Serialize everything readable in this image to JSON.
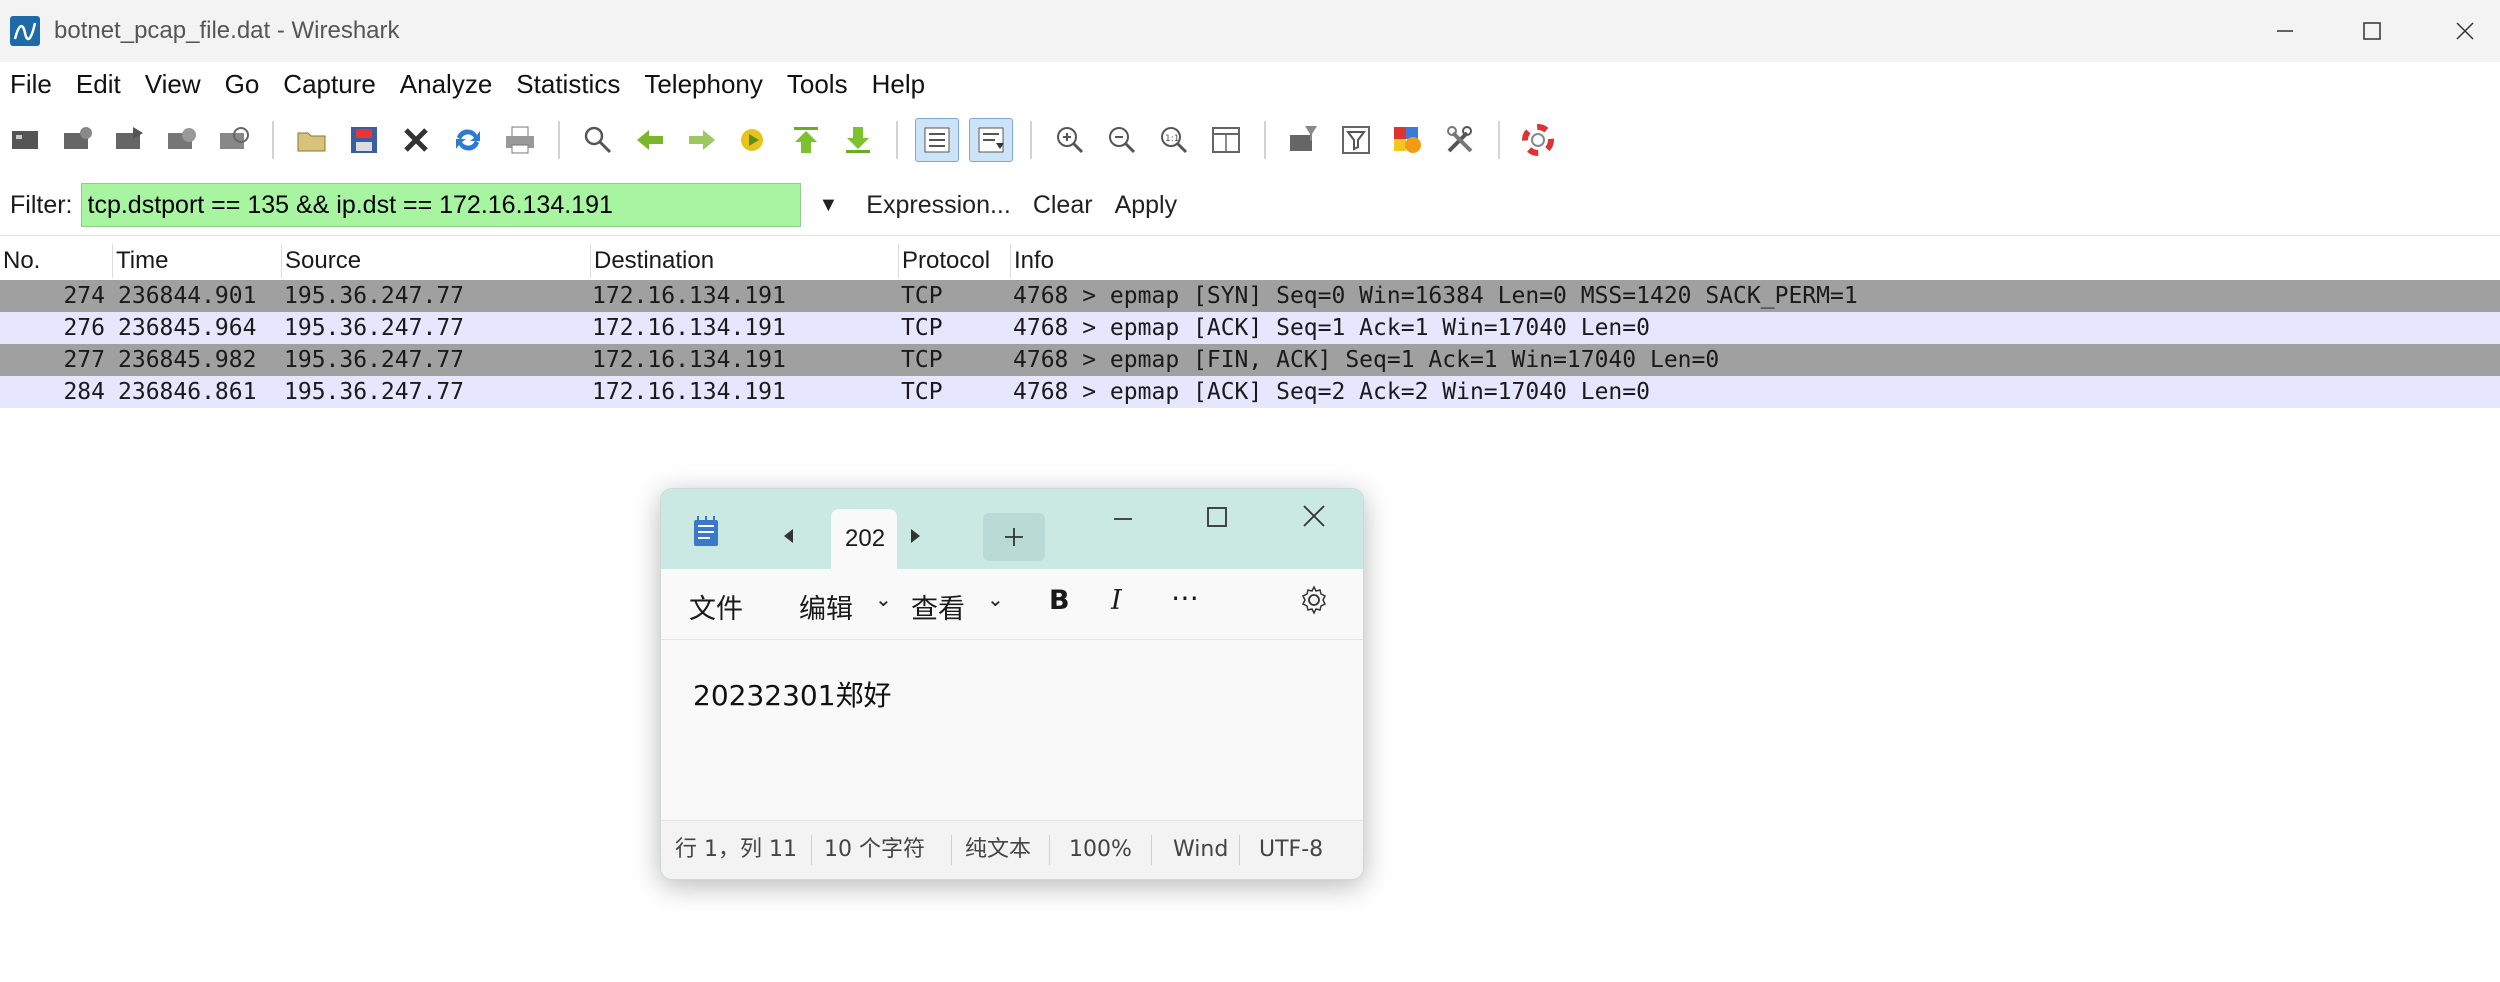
{
  "window": {
    "title": "botnet_pcap_file.dat - Wireshark"
  },
  "menu": [
    "File",
    "Edit",
    "View",
    "Go",
    "Capture",
    "Analyze",
    "Statistics",
    "Telephony",
    "Tools",
    "Help"
  ],
  "toolbar_icons": [
    "interfaces-icon",
    "options-icon",
    "start-capture-icon",
    "stop-capture-icon",
    "restart-capture-icon",
    "open-file-icon",
    "save-file-icon",
    "close-file-icon",
    "reload-icon",
    "print-icon",
    "find-packet-icon",
    "go-back-icon",
    "go-forward-icon",
    "go-to-packet-icon",
    "first-packet-icon",
    "last-packet-icon",
    "colorize-icon",
    "auto-scroll-icon",
    "zoom-in-icon",
    "zoom-out-icon",
    "normal-size-icon",
    "resize-columns-icon",
    "capture-filters-icon",
    "display-filters-icon",
    "coloring-rules-icon",
    "preferences-icon",
    "help-icon"
  ],
  "filter": {
    "label": "Filter:",
    "value": "tcp.dstport == 135 && ip.dst == 172.16.134.191",
    "expression": "Expression...",
    "clear": "Clear",
    "apply": "Apply",
    "bg_color": "#a7f5a1"
  },
  "packet_list": {
    "columns": [
      "No.",
      "Time",
      "Source",
      "Destination",
      "Protocol",
      "Info"
    ],
    "rows": [
      {
        "no": "274",
        "time": "236844.901",
        "source": "195.36.247.77",
        "destination": "172.16.134.191",
        "protocol": "TCP",
        "info": "4768 > epmap [SYN] Seq=0 Win=16384 Len=0 MSS=1420 SACK_PERM=1",
        "bg": "#a0a0a0"
      },
      {
        "no": "276",
        "time": "236845.964",
        "source": "195.36.247.77",
        "destination": "172.16.134.191",
        "protocol": "TCP",
        "info": "4768 > epmap [ACK] Seq=1 Ack=1 Win=17040 Len=0",
        "bg": "#e7e6ff"
      },
      {
        "no": "277",
        "time": "236845.982",
        "source": "195.36.247.77",
        "destination": "172.16.134.191",
        "protocol": "TCP",
        "info": "4768 > epmap [FIN, ACK] Seq=1 Ack=1 Win=17040 Len=0",
        "bg": "#a0a0a0"
      },
      {
        "no": "284",
        "time": "236846.861",
        "source": "195.36.247.77",
        "destination": "172.16.134.191",
        "protocol": "TCP",
        "info": "4768 > epmap [ACK] Seq=2 Ack=2 Win=17040 Len=0",
        "bg": "#e7e6ff"
      }
    ]
  },
  "notepad": {
    "tab_label": "202",
    "menu": {
      "file": "文件",
      "edit": "编辑",
      "view": "查看"
    },
    "content": "20232301郑好",
    "status": {
      "position": "行 1，列 11",
      "chars": "10 个字符",
      "format": "纯文本",
      "zoom": "100%",
      "line_ending": "Wind",
      "encoding": "UTF-8"
    }
  }
}
